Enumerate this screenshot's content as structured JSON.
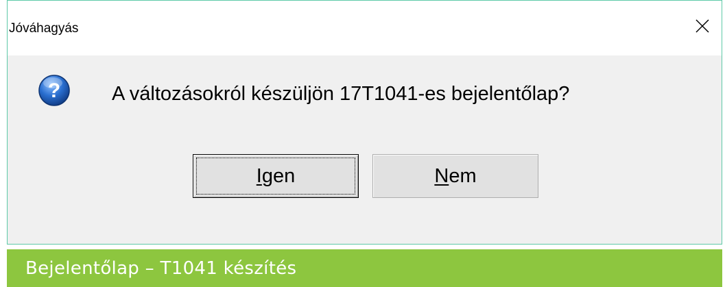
{
  "dialog": {
    "title": "Jóváhagyás",
    "close_icon": "close-icon",
    "question_icon": "question-icon",
    "message": "A változásokról készüljön 17T1041-es bejelentőlap?",
    "buttons": {
      "yes": {
        "mnemonic": "I",
        "rest": "gen"
      },
      "no": {
        "mnemonic": "N",
        "rest": "em"
      }
    }
  },
  "caption": {
    "text": "Bejelentőlap – T1041 készítés"
  },
  "colors": {
    "dialog_border": "#5cc9a7",
    "dialog_background": "#f0f0f0",
    "caption_background": "#8dc63f",
    "question_icon_blue": "#1f5fb4"
  }
}
